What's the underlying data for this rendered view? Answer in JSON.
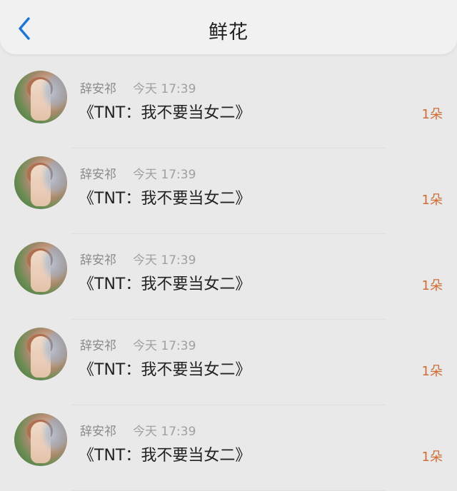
{
  "header": {
    "title": "鲜花",
    "back_icon": "chevron-left-icon",
    "accent": "#1c73d8"
  },
  "items": [
    {
      "user": "辞安祁",
      "time": "今天 17:39",
      "work": "《TNT：我不要当女二》",
      "qty": "1朵"
    },
    {
      "user": "辞安祁",
      "time": "今天 17:39",
      "work": "《TNT：我不要当女二》",
      "qty": "1朵"
    },
    {
      "user": "辞安祁",
      "time": "今天 17:39",
      "work": "《TNT：我不要当女二》",
      "qty": "1朵"
    },
    {
      "user": "辞安祁",
      "time": "今天 17:39",
      "work": "《TNT：我不要当女二》",
      "qty": "1朵"
    },
    {
      "user": "辞安祁",
      "time": "今天 17:39",
      "work": "《TNT：我不要当女二》",
      "qty": "1朵"
    }
  ]
}
